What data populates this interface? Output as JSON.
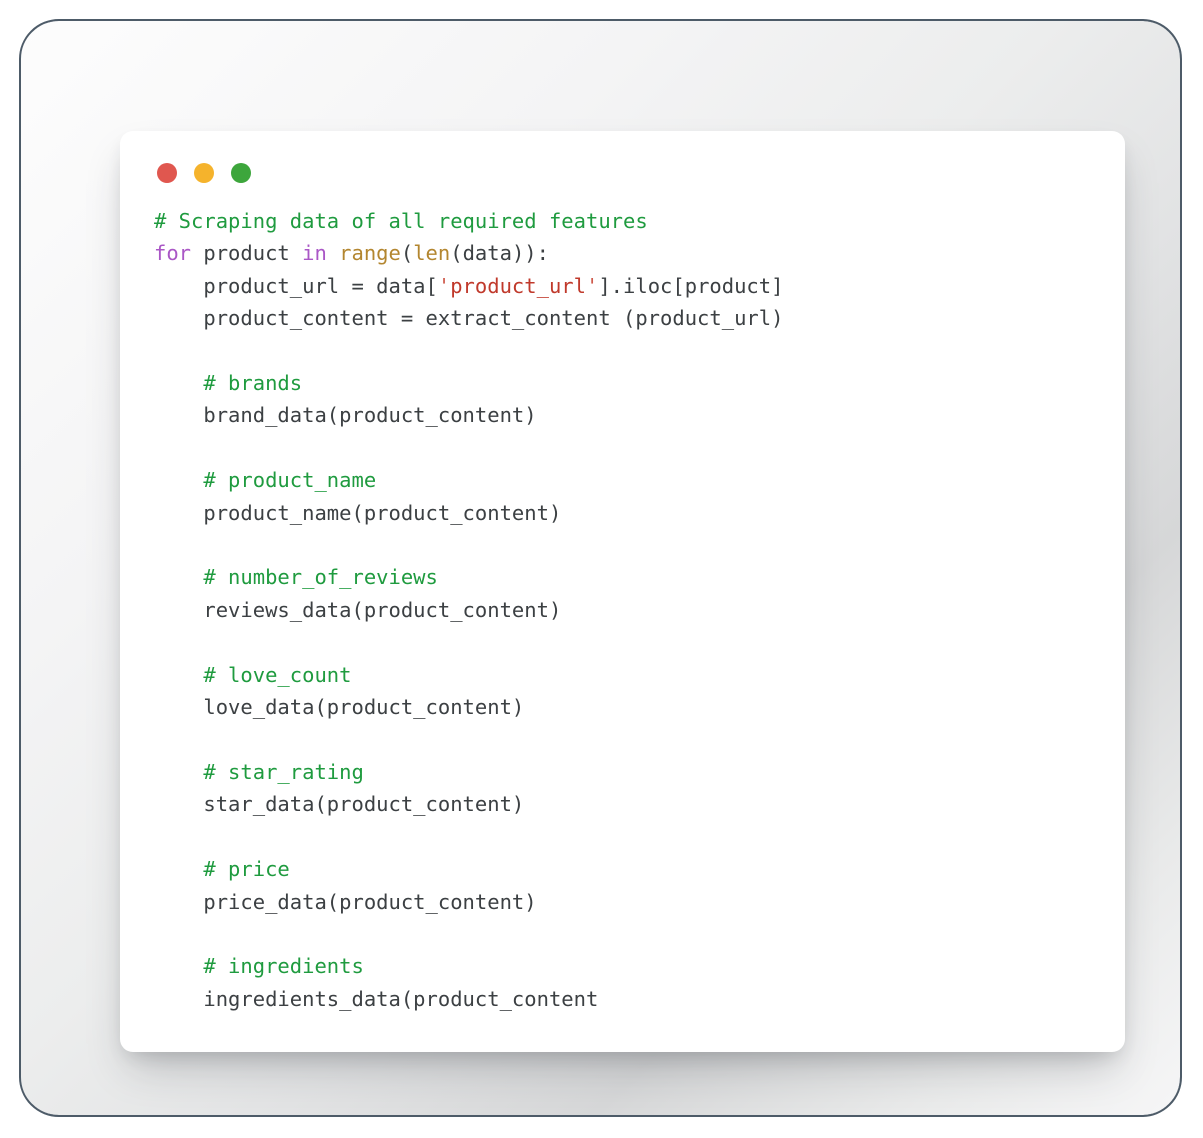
{
  "window": {
    "dots": [
      {
        "name": "close-dot",
        "color": "#e0574f"
      },
      {
        "name": "minimize-dot",
        "color": "#f5b32c"
      },
      {
        "name": "maximize-dot",
        "color": "#3da63c"
      }
    ]
  },
  "theme": {
    "card_background": "#ffffff",
    "frame_border": "#4d5b68",
    "comment": "#1f9b3f",
    "keyword": "#aa57c6",
    "builtin": "#b3862f",
    "string": "#c0392b",
    "quote": "#cf5a4c",
    "plain_text": "#3c4043"
  },
  "code": {
    "language": "python",
    "plain_text": "# Scraping data of all required features\nfor product in range(len(data)):\n    product_url = data['product_url'].iloc[product]\n    product_content = extract_content (product_url)\n\n    # brands\n    brand_data(product_content)\n\n    # product_name\n    product_name(product_content)\n\n    # number_of_reviews\n    reviews_data(product_content)\n\n    # love_count\n    love_data(product_content)\n\n    # star_rating\n    star_data(product_content)\n\n    # price\n    price_data(product_content)\n\n    # ingredients\n    ingredients_data(product_content",
    "lines": [
      {
        "id": "line-1",
        "tokens": [
          {
            "t": "comment",
            "v": "# Scraping data of all required features"
          }
        ]
      },
      {
        "id": "line-2",
        "tokens": [
          {
            "t": "keyword",
            "v": "for"
          },
          {
            "t": "plain",
            "v": " product "
          },
          {
            "t": "keyword",
            "v": "in"
          },
          {
            "t": "plain",
            "v": " "
          },
          {
            "t": "builtin",
            "v": "range"
          },
          {
            "t": "plain",
            "v": "("
          },
          {
            "t": "builtin",
            "v": "len"
          },
          {
            "t": "plain",
            "v": "(data)):"
          }
        ]
      },
      {
        "id": "line-3",
        "tokens": [
          {
            "t": "plain",
            "v": "    product_url = data["
          },
          {
            "t": "quote",
            "v": "'"
          },
          {
            "t": "string",
            "v": "product_url"
          },
          {
            "t": "quote",
            "v": "'"
          },
          {
            "t": "plain",
            "v": "].iloc[product]"
          }
        ]
      },
      {
        "id": "line-4",
        "tokens": [
          {
            "t": "plain",
            "v": "    product_content = extract_content (product_url)"
          }
        ]
      },
      {
        "id": "line-5",
        "tokens": [
          {
            "t": "plain",
            "v": ""
          }
        ]
      },
      {
        "id": "line-6",
        "tokens": [
          {
            "t": "comment",
            "v": "    # brands"
          }
        ]
      },
      {
        "id": "line-7",
        "tokens": [
          {
            "t": "plain",
            "v": "    brand_data(product_content)"
          }
        ]
      },
      {
        "id": "line-8",
        "tokens": [
          {
            "t": "plain",
            "v": ""
          }
        ]
      },
      {
        "id": "line-9",
        "tokens": [
          {
            "t": "comment",
            "v": "    # product_name"
          }
        ]
      },
      {
        "id": "line-10",
        "tokens": [
          {
            "t": "plain",
            "v": "    product_name(product_content)"
          }
        ]
      },
      {
        "id": "line-11",
        "tokens": [
          {
            "t": "plain",
            "v": ""
          }
        ]
      },
      {
        "id": "line-12",
        "tokens": [
          {
            "t": "comment",
            "v": "    # number_of_reviews"
          }
        ]
      },
      {
        "id": "line-13",
        "tokens": [
          {
            "t": "plain",
            "v": "    reviews_data(product_content)"
          }
        ]
      },
      {
        "id": "line-14",
        "tokens": [
          {
            "t": "plain",
            "v": ""
          }
        ]
      },
      {
        "id": "line-15",
        "tokens": [
          {
            "t": "comment",
            "v": "    # love_count"
          }
        ]
      },
      {
        "id": "line-16",
        "tokens": [
          {
            "t": "plain",
            "v": "    love_data(product_content)"
          }
        ]
      },
      {
        "id": "line-17",
        "tokens": [
          {
            "t": "plain",
            "v": ""
          }
        ]
      },
      {
        "id": "line-18",
        "tokens": [
          {
            "t": "comment",
            "v": "    # star_rating"
          }
        ]
      },
      {
        "id": "line-19",
        "tokens": [
          {
            "t": "plain",
            "v": "    star_data(product_content)"
          }
        ]
      },
      {
        "id": "line-20",
        "tokens": [
          {
            "t": "plain",
            "v": ""
          }
        ]
      },
      {
        "id": "line-21",
        "tokens": [
          {
            "t": "comment",
            "v": "    # price"
          }
        ]
      },
      {
        "id": "line-22",
        "tokens": [
          {
            "t": "plain",
            "v": "    price_data(product_content)"
          }
        ]
      },
      {
        "id": "line-23",
        "tokens": [
          {
            "t": "plain",
            "v": ""
          }
        ]
      },
      {
        "id": "line-24",
        "tokens": [
          {
            "t": "comment",
            "v": "    # ingredients"
          }
        ]
      },
      {
        "id": "line-25",
        "tokens": [
          {
            "t": "plain",
            "v": "    ingredients_data(product_content"
          }
        ]
      }
    ]
  }
}
